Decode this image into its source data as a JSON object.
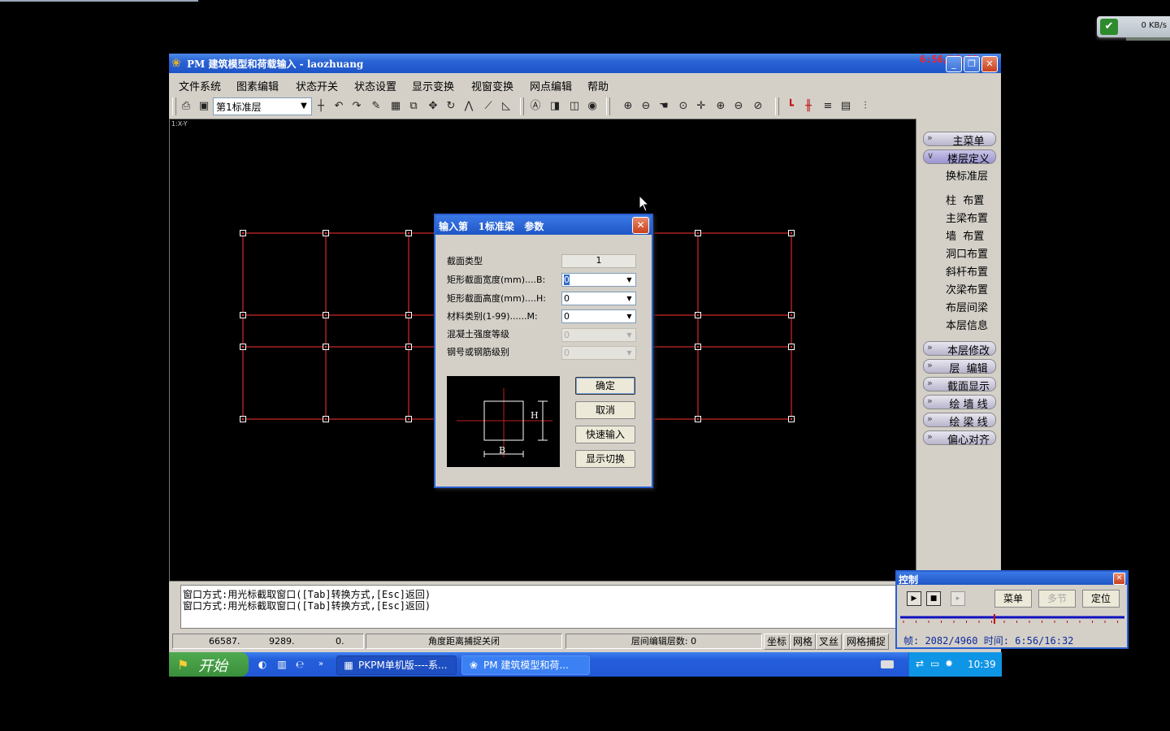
{
  "net_widget": {
    "speed": "0 KB/s"
  },
  "window": {
    "title": "PM 建筑模型和荷载输入 - laozhuang",
    "clock": "6:56/16:32"
  },
  "menu": [
    "文件系统",
    "图素编辑",
    "状态开关",
    "状态设置",
    "显示变换",
    "视窗变换",
    "网点编辑",
    "帮助"
  ],
  "toolbar": {
    "layer_select": "第1标准层"
  },
  "canvas": {
    "corner_label": "1:X-Y",
    "grid_color": "#ff3030"
  },
  "right_panel": {
    "main_menu": "主菜单",
    "floor_def": "楼层定义",
    "sub_items": [
      "换标准层",
      "柱  布置",
      "主梁布置",
      "墙  布置",
      "洞口布置",
      "斜杆布置",
      "次梁布置",
      "布层间梁",
      "本层信息"
    ],
    "lower_buttons": [
      "本层修改",
      "层  编辑",
      "截面显示",
      "绘 墙 线",
      "绘 梁 线",
      "偏心对齐"
    ]
  },
  "command_lines": [
    "窗口方式:用光标截取窗口([Tab]转换方式,[Esc]返回)",
    "窗口方式:用光标截取窗口([Tab]转换方式,[Esc]返回)"
  ],
  "status": {
    "x": "66587.",
    "y": "9289.",
    "z": "0.",
    "snap": "角度距离捕捉关闭",
    "floor_edit": "层间编辑层数:  0",
    "btn_coord": "坐标",
    "btn_grid": "网格",
    "btn_cross": "叉丝",
    "btn_gridsnap": "网格捕捉"
  },
  "taskbar": {
    "start": "开始",
    "task1": "PKPM单机版----系...",
    "task2": "PM 建筑模型和荷...",
    "time": "10:39"
  },
  "dialog": {
    "title": "输入第   1标准梁   参数",
    "fields": [
      {
        "label": "截面类型",
        "value": "1"
      },
      {
        "label": "矩形截面宽度(mm)....B:",
        "value": "0"
      },
      {
        "label": "矩形截面高度(mm)....H:",
        "value": "0"
      },
      {
        "label": "材料类别(1-99)......M:",
        "value": "0"
      },
      {
        "label": "混凝土强度等级",
        "value": "0"
      },
      {
        "label": "钢号或钢筋级别",
        "value": "0"
      }
    ],
    "preview_h": "H",
    "preview_b": "B",
    "buttons": {
      "ok": "确定",
      "cancel": "取消",
      "quick": "快速输入",
      "switch": "显示切换"
    }
  },
  "control": {
    "title": "控制",
    "btn_menu": "菜单",
    "btn_multi": "多节",
    "btn_locate": "定位",
    "frame": "帧: 2082/4960 时间: 6:56/16:32",
    "progress": 0.42
  }
}
